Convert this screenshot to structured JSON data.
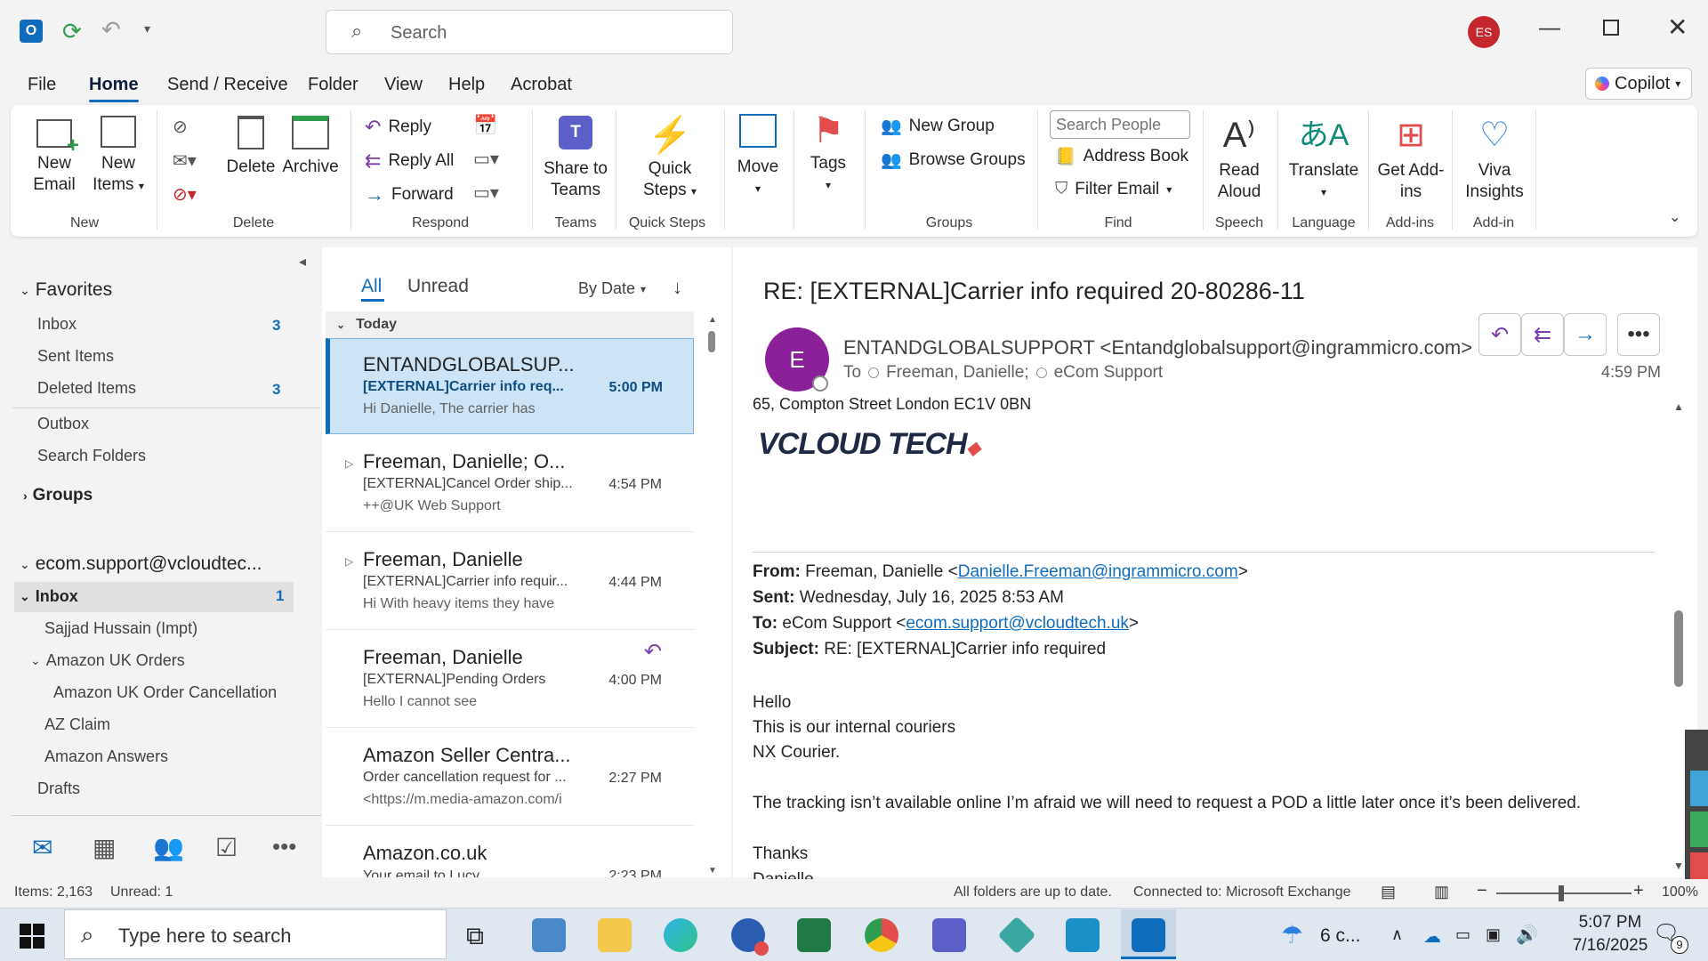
{
  "titlebar": {
    "search_placeholder": "Search",
    "avatar_initials": "ES",
    "copilot_label": "Copilot"
  },
  "menu": {
    "tabs": [
      "File",
      "Home",
      "Send / Receive",
      "Folder",
      "View",
      "Help",
      "Acrobat"
    ],
    "active": "Home"
  },
  "ribbon": {
    "new_email": "New Email",
    "new_items": "New Items",
    "delete": "Delete",
    "archive": "Archive",
    "reply": "Reply",
    "reply_all": "Reply All",
    "forward": "Forward",
    "share_to_teams": "Share to Teams",
    "quick_steps": "Quick Steps",
    "move": "Move",
    "tags": "Tags",
    "new_group": "New Group",
    "browse_groups": "Browse Groups",
    "search_people_placeholder": "Search People",
    "address_book": "Address Book",
    "filter_email": "Filter Email",
    "read_aloud": "Read Aloud",
    "translate": "Translate",
    "get_addins": "Get Add-ins",
    "viva_insights": "Viva Insights",
    "groups_labels": {
      "new": "New",
      "delete": "Delete",
      "respond": "Respond",
      "teams": "Teams",
      "quick_steps": "Quick Steps",
      "move": "",
      "groups": "Groups",
      "find": "Find",
      "speech": "Speech",
      "language": "Language",
      "addins": "Add-ins",
      "addin": "Add-in"
    }
  },
  "folders": {
    "favorites_label": "Favorites",
    "favorites": [
      {
        "name": "Inbox",
        "count": "3"
      },
      {
        "name": "Sent Items",
        "count": ""
      },
      {
        "name": "Deleted Items",
        "count": "3"
      }
    ],
    "outbox": "Outbox",
    "search_folders": "Search Folders",
    "groups_label": "Groups",
    "account": "ecom.support@vcloudtec...",
    "inbox": {
      "name": "Inbox",
      "count": "1"
    },
    "subfolders": [
      "Sajjad Hussain (Impt)",
      "Amazon UK Orders",
      "Amazon UK Order Cancellation",
      "AZ Claim",
      "Amazon Answers",
      "Drafts"
    ]
  },
  "message_list": {
    "tab_all": "All",
    "tab_unread": "Unread",
    "sort_label": "By Date",
    "group_header": "Today",
    "messages": [
      {
        "sender": "ENTANDGLOBALSUP...",
        "subject": "[EXTERNAL]Carrier info req...",
        "preview": "Hi Danielle,   The carrier has",
        "time": "5:00 PM"
      },
      {
        "sender": "Freeman, Danielle;  O...",
        "subject": "[EXTERNAL]Cancel Order ship...",
        "preview": "++@UK  Web Support",
        "time": "4:54 PM"
      },
      {
        "sender": "Freeman, Danielle",
        "subject": "[EXTERNAL]Carrier info requir...",
        "preview": "Hi  With heavy items they have",
        "time": "4:44 PM"
      },
      {
        "sender": "Freeman, Danielle",
        "subject": "[EXTERNAL]Pending Orders",
        "preview": "Hello  I cannot see",
        "time": "4:00 PM"
      },
      {
        "sender": "Amazon Seller Centra...",
        "subject": "Order cancellation request for ...",
        "preview": "<https://m.media-amazon.com/i",
        "time": "2:27 PM"
      },
      {
        "sender": "Amazon.co.uk",
        "subject": "Your email to Lucy",
        "preview": "",
        "time": "2:23 PM"
      }
    ]
  },
  "reading": {
    "subject": "RE: [EXTERNAL]Carrier info required 20-80286-11",
    "avatar_letter": "E",
    "from_line": "ENTANDGLOBALSUPPORT <Entandglobalsupport@ingrammicro.com>",
    "to_label": "To",
    "recipients": [
      "Freeman, Danielle;",
      "eCom Support"
    ],
    "time": "4:59 PM",
    "address": "65, Compton Street London EC1V 0BN",
    "logo_text": "VCLOUD TECH",
    "from_label": "From:",
    "from_value": "Freeman, Danielle <",
    "from_email": "Danielle.Freeman@ingrammicro.com",
    "sent_label": "Sent:",
    "sent_value": "Wednesday, July 16, 2025 8:53 AM",
    "to_hdr_label": "To:",
    "to_value": "eCom Support <",
    "to_email": "ecom.support@vcloudtech.uk",
    "subject_label": "Subject:",
    "subject_value": "RE: [EXTERNAL]Carrier info required",
    "body": [
      "Hello",
      "This is our internal couriers",
      "NX Courier.",
      "The tracking isn’t available online I’m afraid we will need to request a POD a little later once it’s been delivered.",
      "Thanks",
      "Danielle"
    ]
  },
  "status": {
    "items": "Items: 2,163",
    "unread": "Unread: 1",
    "sync": "All folders are up to date.",
    "connection": "Connected to: Microsoft Exchange",
    "zoom": "100%"
  },
  "taskbar": {
    "search_placeholder": "Type here to search",
    "weather": "6 c...",
    "time": "5:07 PM",
    "date": "7/16/2025",
    "notif_count": "9"
  }
}
